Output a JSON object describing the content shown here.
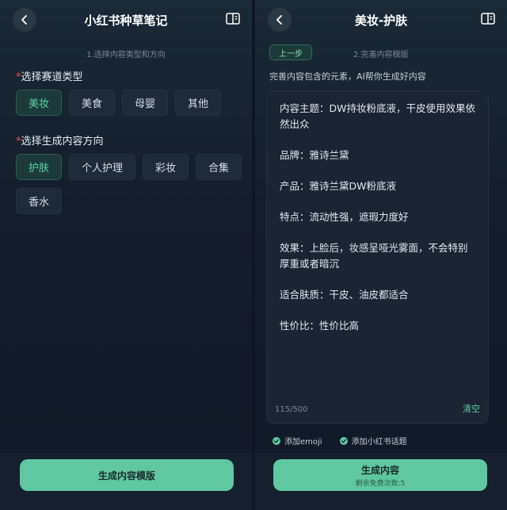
{
  "left": {
    "nav": {
      "title": "小红书种草笔记"
    },
    "step_hint": "1.选择内容类型和方向",
    "track_label": "选择赛道类型",
    "track_required": "*",
    "tracks": [
      "美妆",
      "美食",
      "母婴",
      "其他"
    ],
    "track_selected": "美妆",
    "direction_label": "选择生成内容方向",
    "direction_required": "*",
    "directions": [
      "护肤",
      "个人护理",
      "彩妆",
      "合集",
      "香水"
    ],
    "direction_selected": "护肤",
    "generate_template_label": "生成内容模版"
  },
  "right": {
    "nav": {
      "title": "美妆-护肤"
    },
    "prev_label": "上一步",
    "step_hint": "2.完善内容模版",
    "description": "完善内容包含的元素，AI帮你生成好内容",
    "content_lines": [
      "内容主题：DW持妆粉底液，干皮使用效果依然出众",
      "品牌：雅诗兰黛",
      "产品：雅诗兰黛DW粉底液",
      "特点：流动性强，遮瑕力度好",
      "效果：上脸后，妆感呈哑光雾面，不会特别厚重或者暗沉",
      "适合肤质：干皮、油皮都适合",
      "性价比：性价比高"
    ],
    "counter": "115/500",
    "clear_label": "清空",
    "options": [
      "添加emoji",
      "添加小红书话题"
    ],
    "generate_label": "生成内容",
    "remaining_label": "剩余免费次数:5"
  },
  "colors": {
    "accent": "#5fc7a1",
    "accent_text": "#5ad1a5",
    "required": "#e5534b"
  },
  "icons": {
    "back": "chevron-left-icon",
    "book": "book-icon",
    "check": "check-circle-icon"
  }
}
